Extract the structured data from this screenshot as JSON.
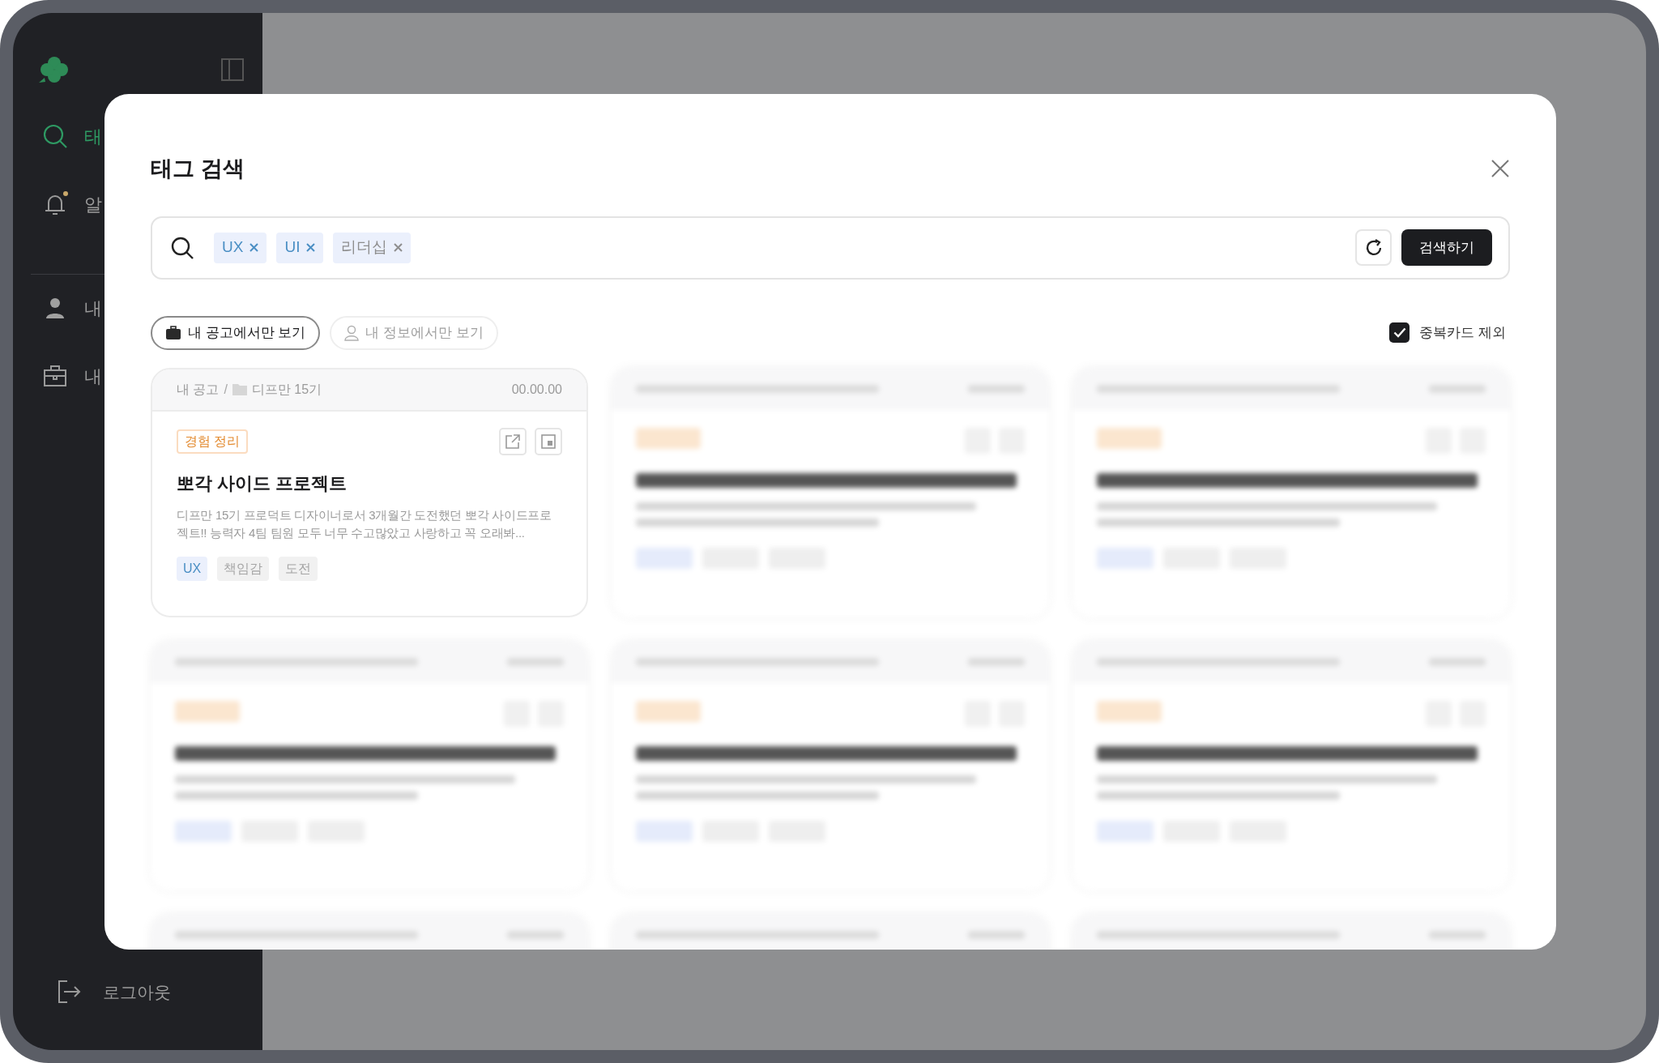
{
  "sidebar": {
    "nav": [
      {
        "kind": "search",
        "label": "태",
        "selected": true,
        "dot": false
      },
      {
        "kind": "bell",
        "label": "알",
        "selected": false,
        "dot": true
      },
      {
        "kind": "person",
        "label": "내",
        "selected": false,
        "dot": false
      },
      {
        "kind": "briefcase",
        "label": "내",
        "selected": false,
        "dot": false
      }
    ],
    "logout": "로그아웃"
  },
  "modal": {
    "title": "태그 검색",
    "search_tags": [
      {
        "label": "UX",
        "highlighted": true
      },
      {
        "label": "UI",
        "highlighted": true
      },
      {
        "label": "리더십",
        "highlighted": false
      }
    ],
    "search_button": "검색하기",
    "filters": [
      {
        "kind": "briefcase",
        "label": "내 공고에서만 보기",
        "selected": true
      },
      {
        "kind": "person",
        "label": "내 정보에서만 보기",
        "selected": false
      }
    ],
    "exclude_duplicates": {
      "label": "중복카드 제외",
      "checked": true
    },
    "cards": [
      {
        "kind": "full",
        "breadcrumb": "내 공고",
        "separator": "/",
        "folder": "디프만 15기",
        "date": "00.00.00",
        "category": "경험 정리",
        "title": "뽀각 사이드 프로젝트",
        "description": "디프만 15기 프로덕트 디자이너로서 3개월간 도전했던 뽀각 사이드프로젝트!! 능력자 4팀 팀원 모두 너무 수고많았고 사랑하고 꼭 오래봐...",
        "tags": [
          {
            "label": "UX",
            "highlighted": true
          },
          {
            "label": "책임감",
            "highlighted": false
          },
          {
            "label": "도전",
            "highlighted": false
          }
        ]
      },
      {
        "kind": "blurred"
      },
      {
        "kind": "blurred"
      },
      {
        "kind": "blurred"
      },
      {
        "kind": "blurred"
      },
      {
        "kind": "blurred"
      },
      {
        "kind": "blurred"
      },
      {
        "kind": "blurred"
      },
      {
        "kind": "blurred"
      }
    ]
  }
}
